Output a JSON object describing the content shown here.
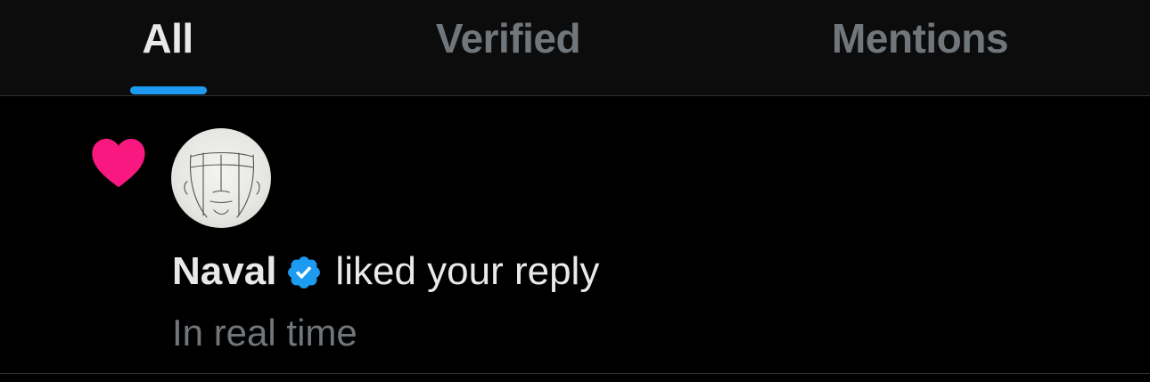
{
  "tabs": [
    {
      "label": "All",
      "active": true
    },
    {
      "label": "Verified",
      "active": false
    },
    {
      "label": "Mentions",
      "active": false
    }
  ],
  "notification": {
    "icon": "heart-icon",
    "user_name": "Naval",
    "verified": true,
    "action": "liked your reply",
    "subtext": "In real time"
  },
  "colors": {
    "accent": "#1d9bf0",
    "like": "#f91880",
    "text_primary": "#e7e9ea",
    "text_secondary": "#71767b",
    "background": "#000000"
  }
}
